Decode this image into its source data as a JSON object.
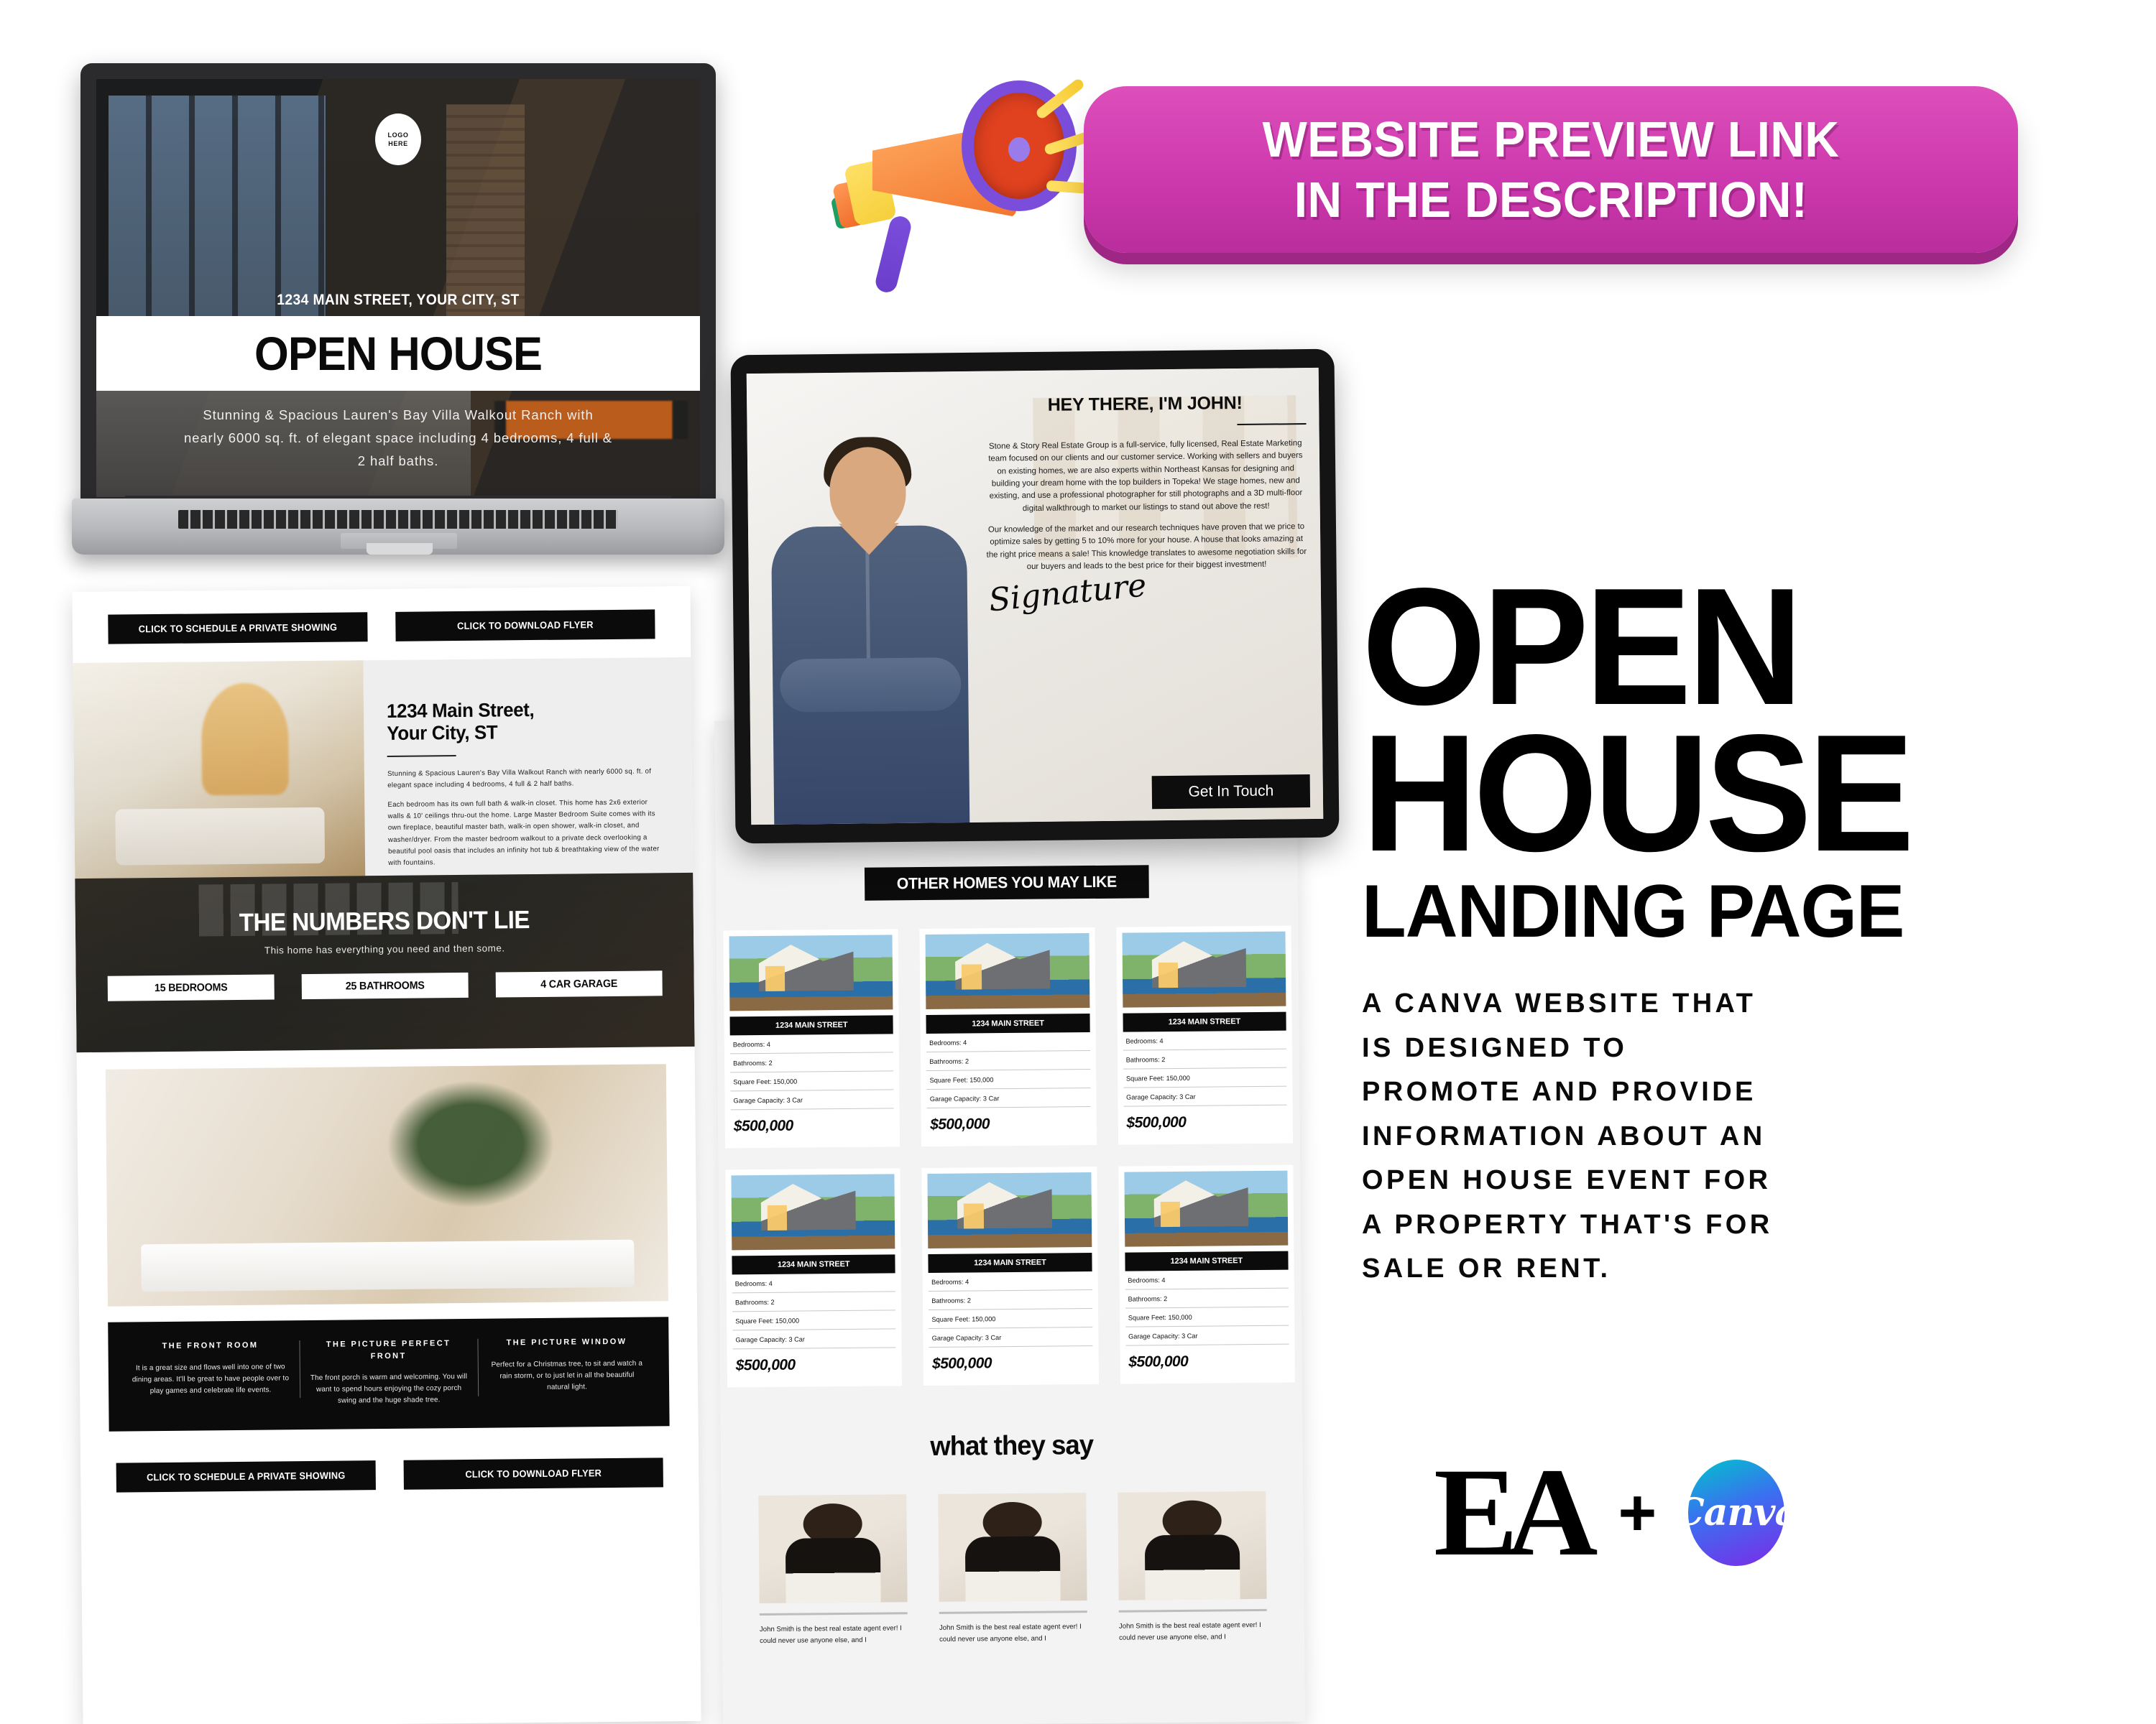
{
  "banner": {
    "line1": "WEBSITE PREVIEW LINK",
    "line2": "IN THE DESCRIPTION!",
    "color": "#cc38ad",
    "shadow_color": "#9e2684",
    "megaphone_icon": "megaphone-icon"
  },
  "right_column": {
    "title_line1": "OPEN",
    "title_line2": "HOUSE",
    "subtitle": "LANDING PAGE",
    "description_lines": [
      "A CANVA WEBSITE THAT",
      "IS DESIGNED TO",
      "PROMOTE AND PROVIDE",
      "INFORMATION ABOUT AN",
      "OPEN HOUSE EVENT FOR",
      "A PROPERTY THAT'S FOR",
      "SALE OR RENT."
    ]
  },
  "brands": {
    "ea_logo": "EA",
    "plus": "+",
    "canva_label": "Canva",
    "canva_gradient_start": "#00c4cc",
    "canva_gradient_end": "#7d2ae8"
  },
  "laptop": {
    "logo_badge_line1": "LOGO",
    "logo_badge_line2": "HERE",
    "address": "1234 MAIN STREET, YOUR CITY, ST",
    "headline": "OPEN HOUSE",
    "subtext": "Stunning & Spacious Lauren's Bay Villa Walkout Ranch with nearly 6000 sq. ft. of elegant space including 4 bedrooms, 4 full & 2 half baths."
  },
  "tablet": {
    "title": "HEY THERE, I'M JOHN!",
    "paragraph1": "Stone & Story Real Estate Group is a full-service, fully licensed, Real Estate Marketing team focused on our clients and our customer service. Working with sellers and buyers on existing homes, we are also experts within Northeast Kansas for designing and building your dream home with the top builders in Topeka! We stage homes, new and existing, and use a professional photographer for still photographs and a 3D multi-floor digital walkthrough to market our listings to stand out above the rest!",
    "paragraph2": "Our knowledge of the market and our research techniques have proven that we price to optimize sales by getting 5 to 10% more for your house. A house that looks amazing at the right price means a sale! This knowledge translates to awesome negotiation skills for our buyers and leads to the best price for their biggest investment!",
    "signature": "Signature",
    "cta_label": "Get In Touch"
  },
  "left_page": {
    "btn_schedule": "CLICK TO SCHEDULE A PRIVATE SHOWING",
    "btn_flyer": "CLICK TO DOWNLOAD FLYER",
    "address_line1": "1234 Main Street,",
    "address_line2": "Your City, ST",
    "body1": "Stunning & Spacious Lauren's Bay Villa Walkout Ranch with nearly 6000 sq. ft. of elegant space including 4 bedrooms, 4 full & 2 half baths.",
    "body2": "Each bedroom has its own full bath & walk-in closet. This home has 2x6 exterior walls & 10' ceilings thru-out the home. Large Master Bedroom Suite comes with its own fireplace, beautiful master bath, walk-in open shower, walk-in closet, and washer/dryer. From the master bedroom walkout to a private deck overlooking a beautiful pool oasis that includes an infinity hot tub & breathtaking view of the water with fountains.",
    "numbers_title": "THE NUMBERS DON'T LIE",
    "numbers_sub": "This home has everything you need and then some.",
    "stats": [
      "15 BEDROOMS",
      "25 BATHROOMS",
      "4 CAR GARAGE"
    ],
    "columns": [
      {
        "title": "THE FRONT ROOM",
        "text": "It is a great size and flows well into one of two dining areas. It'll be great to have people over to play games and celebrate life events."
      },
      {
        "title": "THE PICTURE PERFECT FRONT",
        "text": "The front porch is warm and welcoming. You will want to spend hours enjoying the cozy porch swing and the huge shade tree."
      },
      {
        "title": "THE PICTURE WINDOW",
        "text": "Perfect for a Christmas tree, to sit and watch a rain storm, or to just let in all the beautiful natural light."
      }
    ]
  },
  "mid_page": {
    "section_title": "OTHER HOMES YOU MAY LIKE",
    "card_labels": [
      "Bedrooms: 4",
      "Bathrooms: 2",
      "Square Feet: 150,000",
      "Garage Capacity: 3 Car"
    ],
    "card_address": "1234 MAIN STREET",
    "card_price": "$500,000",
    "card_count": 6,
    "testimonials_title": "what they say",
    "testimonial_quote": "John Smith is the best real estate agent ever! I could never use anyone else, and I",
    "testimonial_count": 3
  }
}
